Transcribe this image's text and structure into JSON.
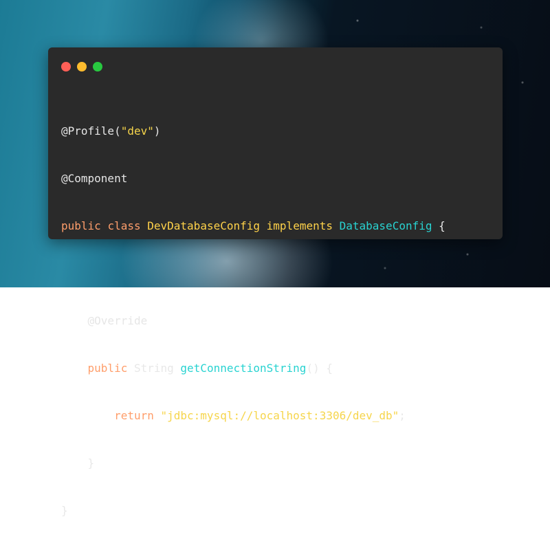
{
  "window": {
    "buttons": [
      "close",
      "minimize",
      "maximize"
    ],
    "colors": {
      "close": "#ff5f57",
      "minimize": "#febc2e",
      "maximize": "#28c840"
    }
  },
  "code": {
    "line1": {
      "annotation": "@Profile(",
      "string": "\"dev\"",
      "close": ")"
    },
    "line2": {
      "annotation": "@Component"
    },
    "line3": {
      "kw1": "public",
      "kw2": "class",
      "class_name": "DevDatabaseConfig",
      "implements": "implements",
      "interface": "DatabaseConfig",
      "brace": "{"
    },
    "line5": {
      "indent": "    ",
      "annotation": "@Override"
    },
    "line6": {
      "indent": "    ",
      "kw": "public",
      "type": "String",
      "method": "getConnectionString",
      "rest": "() {"
    },
    "line7": {
      "indent": "        ",
      "kw": "return",
      "string": "\"jdbc:mysql://localhost:3306/dev_db\"",
      "semicolon": ";"
    },
    "line8": {
      "indent": "    ",
      "brace": "}"
    },
    "line9": {
      "brace": "}"
    }
  }
}
